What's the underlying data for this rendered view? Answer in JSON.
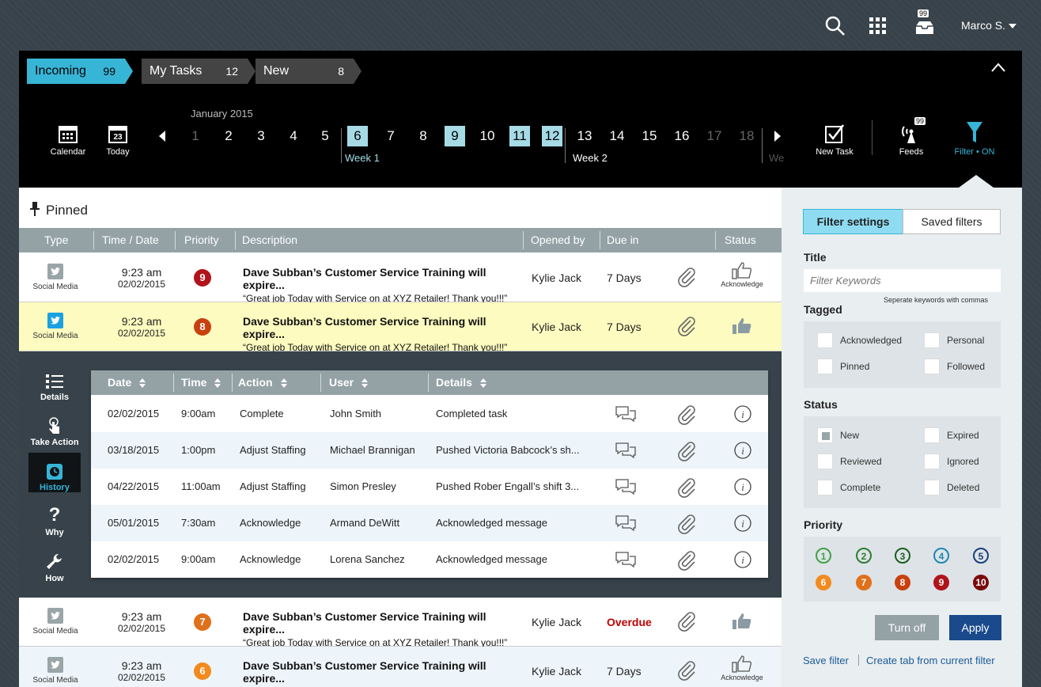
{
  "topbar": {
    "inbox_count": "99",
    "user": "Marco S."
  },
  "tabs": [
    {
      "label": "Incoming",
      "count": "99"
    },
    {
      "label": "My Tasks",
      "count": "12"
    },
    {
      "label": "New",
      "count": "8"
    }
  ],
  "toolbar": {
    "calendar": "Calendar",
    "today": "Today",
    "today_day": "23",
    "new_task": "New Task",
    "feeds": "Feeds",
    "feeds_count": "99",
    "filter": "Filter • ON"
  },
  "calendar": {
    "month": "January 2015",
    "days": [
      "1",
      "2",
      "3",
      "4",
      "5",
      "6",
      "7",
      "8",
      "9",
      "10",
      "11",
      "12",
      "13",
      "14",
      "15",
      "16",
      "17",
      "18"
    ],
    "week1": "Week 1",
    "week2": "Week 2",
    "week3": "We"
  },
  "pinned": {
    "title": "Pinned"
  },
  "table": {
    "headers": {
      "type": "Type",
      "time": "Time / Date",
      "priority": "Priority",
      "description": "Description",
      "opened": "Opened by",
      "due": "Due in",
      "status": "Status"
    },
    "rows": [
      {
        "type": "Social Media",
        "time": "9:23 am",
        "date": "02/02/2015",
        "priority": "9",
        "title": "Dave Subban’s Customer Service Training will expire...",
        "sub": "“Great job Today with Service on at XYZ Retailer! Thank you!!!”",
        "opened": "Kylie Jack",
        "due": "7 Days",
        "status": "Acknowledge"
      },
      {
        "type": "Social Media",
        "time": "9:23 am",
        "date": "02/02/2015",
        "priority": "8",
        "title": "Dave Subban’s Customer Service Training will expire...",
        "sub": "“Great job Today with Service on at XYZ Retailer! Thank you!!!”",
        "opened": "Kylie Jack",
        "due": "7 Days",
        "status": ""
      },
      {
        "type": "Social Media",
        "time": "9:23 am",
        "date": "02/02/2015",
        "priority": "7",
        "title": "Dave Subban’s Customer Service Training will expire...",
        "sub": "“Great job Today with Service on at XYZ Retailer! Thank you!!!”",
        "opened": "Kylie Jack",
        "due": "Overdue",
        "status": ""
      },
      {
        "type": "Social Media",
        "time": "9:23 am",
        "date": "02/02/2015",
        "priority": "6",
        "title": "Dave Subban’s Customer Service Training will expire...",
        "sub": "“Great job Today with Service on at XYZ Retailer! Thank you!!!”",
        "opened": "Kylie Jack",
        "due": "7 Days",
        "status": "Acknowledge"
      }
    ]
  },
  "detail_nav": [
    "Details",
    "Take Action",
    "History",
    "Why",
    "How"
  ],
  "history": {
    "headers": {
      "date": "Date",
      "time": "Time",
      "action": "Action",
      "user": "User",
      "details": "Details"
    },
    "rows": [
      {
        "date": "02/02/2015",
        "time": "9:00am",
        "action": "Complete",
        "user": "John Smith",
        "details": "Completed task"
      },
      {
        "date": "03/18/2015",
        "time": "1:00pm",
        "action": "Adjust Staffing",
        "user": "Michael Brannigan",
        "details": "Pushed Victoria Babcock’s sh..."
      },
      {
        "date": "04/22/2015",
        "time": "11:00am",
        "action": "Adjust Staffing",
        "user": "Simon Presley",
        "details": "Pushed Rober Engall’s shift 3..."
      },
      {
        "date": "05/01/2015",
        "time": "7:30am",
        "action": "Acknowledge",
        "user": "Armand DeWitt",
        "details": "Acknowledged message"
      },
      {
        "date": "02/02/2015",
        "time": "9:00am",
        "action": "Acknowledge",
        "user": "Lorena Sanchez",
        "details": "Acknowledged message"
      }
    ]
  },
  "filter": {
    "seg_settings": "Filter settings",
    "seg_saved": "Saved filters",
    "title_label": "Title",
    "keywords_placeholder": "Filter Keywords",
    "keywords_hint": "Seperate keywords with commas",
    "tagged_label": "Tagged",
    "tagged": [
      "Acknowledged",
      "Personal",
      "Pinned",
      "Followed"
    ],
    "status_label": "Status",
    "status": [
      "New",
      "Expired",
      "Reviewed",
      "Ignored",
      "Complete",
      "Deleted"
    ],
    "priority_label": "Priority",
    "priorities": [
      "1",
      "2",
      "3",
      "4",
      "5",
      "6",
      "7",
      "8",
      "9",
      "10"
    ],
    "turn_off": "Turn off",
    "apply": "Apply",
    "save_filter": "Save filter",
    "create_tab": "Create tab from current filter"
  },
  "colors": {
    "accent": "#37b5d6",
    "p1": "#43a047",
    "p2": "#2e7d32",
    "p3": "#1b5e20",
    "p4": "#1e88b5",
    "p5": "#1a3f7a",
    "p6": "#f28a1e",
    "p7": "#e0701a",
    "p8": "#c9400f",
    "p9": "#b0141a",
    "p10": "#7a0a0a",
    "overdue": "#c00000"
  }
}
